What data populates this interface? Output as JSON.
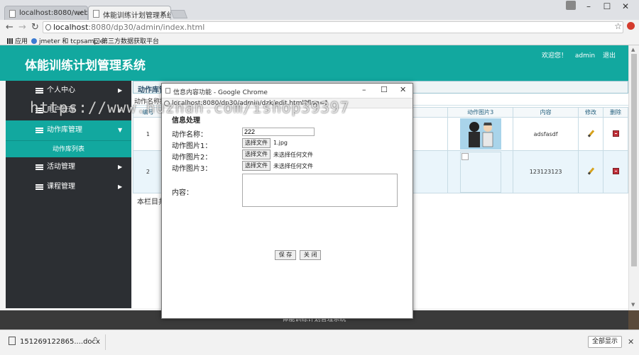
{
  "browser": {
    "tabs": [
      {
        "label": "localhost:8080/webto"
      },
      {
        "label": "体能训练计划管理系统"
      }
    ],
    "url_host": "localhost",
    "url_rest": ":8080/dp30/admin/index.html",
    "bookmarks": [
      {
        "label": "应用"
      },
      {
        "label": "jmeter 和 tcpsample"
      },
      {
        "label": "第三方数据获取平台"
      }
    ]
  },
  "header": {
    "title": "体能训练计划管理系统",
    "welcome": "欢迎您！",
    "user": "admin",
    "logout": "退出"
  },
  "sidebar": {
    "items": [
      {
        "label": "个人中心"
      },
      {
        "label": "用户管理"
      },
      {
        "label": "动作库管理"
      },
      {
        "label": "活动管理"
      },
      {
        "label": "课程管理"
      }
    ],
    "submenu_label": "动作库列表"
  },
  "content": {
    "breadcrumb": "动作库管",
    "subbar": "动作名称搜",
    "columns": [
      "编号",
      "动作图片3",
      "内容",
      "修改",
      "删除"
    ],
    "rows": [
      {
        "id": "1",
        "content": "adsfasdf"
      },
      {
        "id": "2",
        "content": "123123123"
      }
    ],
    "footnote": "本栏目共"
  },
  "footer_text": "体能训练计划管理系统",
  "popup": {
    "window_title": "信息内容功能 - Google Chrome",
    "url": "localhost:8080/dp30/admin/dzk/edit.html?flag=1",
    "form_title": "信息处理",
    "name_label": "动作名称：",
    "name_value": "222",
    "img1_label": "动作图片1：",
    "img2_label": "动作图片2：",
    "img3_label": "动作图片3：",
    "file_button": "选择文件",
    "img1_file": "1.jpg",
    "img2_file": "未选择任何文件",
    "img3_file": "未选择任何文件",
    "content_label": "内容：",
    "save": "保 存",
    "close": "关 闭"
  },
  "downloads": {
    "file": "151269122865....docx",
    "show_all": "全部显示"
  },
  "watermark": "https://www.huzhan.com/ishop39397",
  "colors": {
    "accent": "#12a89f",
    "sidebar": "#2c2f33"
  }
}
